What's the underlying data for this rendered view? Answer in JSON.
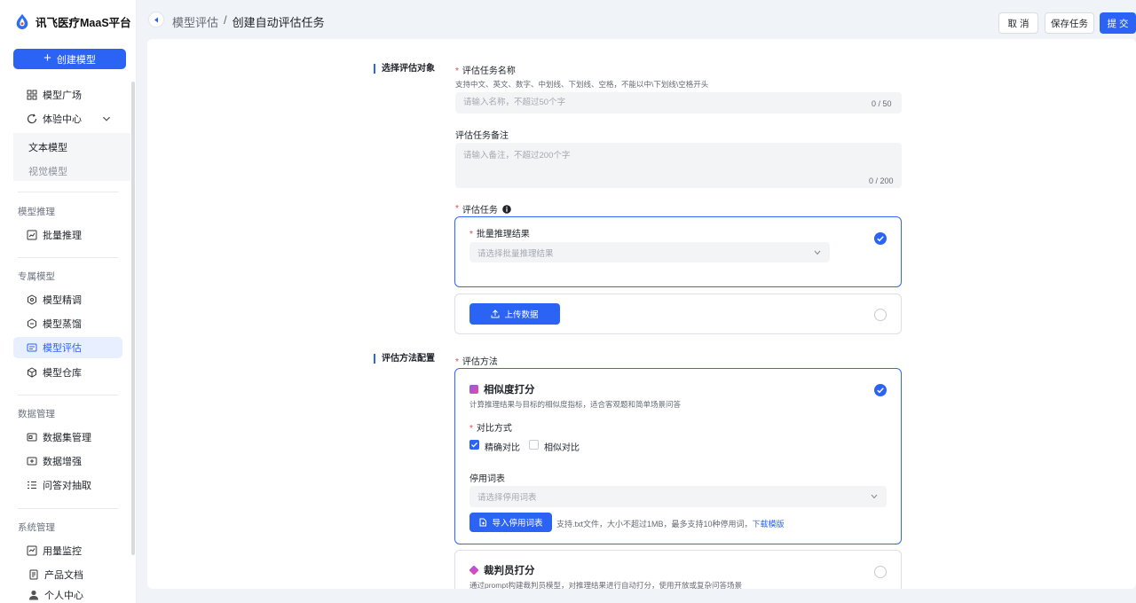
{
  "app": {
    "title": "讯飞医疗MaaS平台"
  },
  "sidebar": {
    "create_button": "创建模型",
    "top_items": [
      "模型广场",
      "体验中心"
    ],
    "sub_items": [
      "文本模型",
      "视觉模型"
    ],
    "groups": [
      {
        "title": "模型推理",
        "items": [
          "批量推理"
        ]
      },
      {
        "title": "专属模型",
        "items": [
          "模型精调",
          "模型蒸馏",
          "模型评估",
          "模型仓库"
        ]
      },
      {
        "title": "数据管理",
        "items": [
          "数据集管理",
          "数据增强",
          "问答对抽取"
        ]
      },
      {
        "title": "系统管理",
        "items": [
          "用量监控",
          "产品文档",
          "个人中心"
        ]
      }
    ],
    "active_item": "模型评估"
  },
  "header": {
    "breadcrumb": [
      "模型评估",
      "/",
      "创建自动评估任务"
    ],
    "cancel_label": "取 消",
    "save_label": "保存任务",
    "submit_label": "提 交"
  },
  "form": {
    "section1_title": "选择评估对象",
    "name_label": "评估任务名称",
    "name_hint": "支持中文、英文、数字、中划线、下划线、空格，不能以中\\下划线\\空格开头",
    "name_placeholder": "请输入名称，不超过50个字",
    "name_count": "0 / 50",
    "note_label": "评估任务备注",
    "note_placeholder": "请输入备注，不超过200个字",
    "note_count": "0 / 200",
    "task_label": "评估任务",
    "batch_label": "批量推理结果",
    "batch_placeholder": "请选择批量推理结果",
    "upload_label": "上传数据",
    "section2_title": "评估方法配置",
    "method_label": "评估方法",
    "similarity": {
      "title": "相似度打分",
      "desc": "计算推理结果与目标的相似度指标，适合客观题和简单场景问答",
      "compare_label": "对比方式",
      "exact_label": "精确对比",
      "similar_label": "相似对比",
      "stopwords_label": "停用词表",
      "stopwords_placeholder": "请选择停用词表",
      "import_label": "导入停用词表",
      "import_hint": "支持.txt文件，大小不超过1MB，最多支持10种停用词，",
      "template_link": "下载模版"
    },
    "judge": {
      "title": "裁判员打分",
      "desc": "通过prompt构建裁判员模型，对推理结果进行自动打分，使用开放或复杂问答场景"
    }
  },
  "colors": {
    "primary": "#2b63f5",
    "required": "#e5484d"
  }
}
